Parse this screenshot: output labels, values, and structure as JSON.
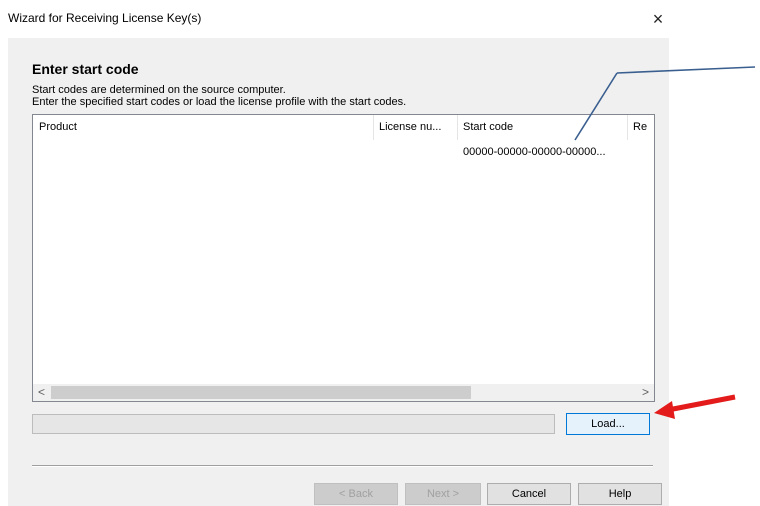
{
  "window": {
    "title": "Wizard for Receiving License Key(s)"
  },
  "page": {
    "heading": "Enter start code",
    "desc_line1": "Start codes are determined on the source computer.",
    "desc_line2": "Enter the specified start codes or load the license profile with the start codes."
  },
  "table": {
    "columns": [
      "Product",
      "License nu...",
      "Start code",
      "Re"
    ],
    "rows": [
      {
        "product": "",
        "license": "",
        "start_code": "00000-00000-00000-00000...",
        "re": ""
      }
    ]
  },
  "buttons": {
    "load": "Load...",
    "back": "< Back",
    "next": "Next >",
    "cancel": "Cancel",
    "help": "Help"
  },
  "icons": {
    "close": "×",
    "scroll_left": "<",
    "scroll_right": ">"
  },
  "annotation_colors": {
    "callout_line": "#3a5f8f",
    "arrow": "#e31b1b"
  }
}
